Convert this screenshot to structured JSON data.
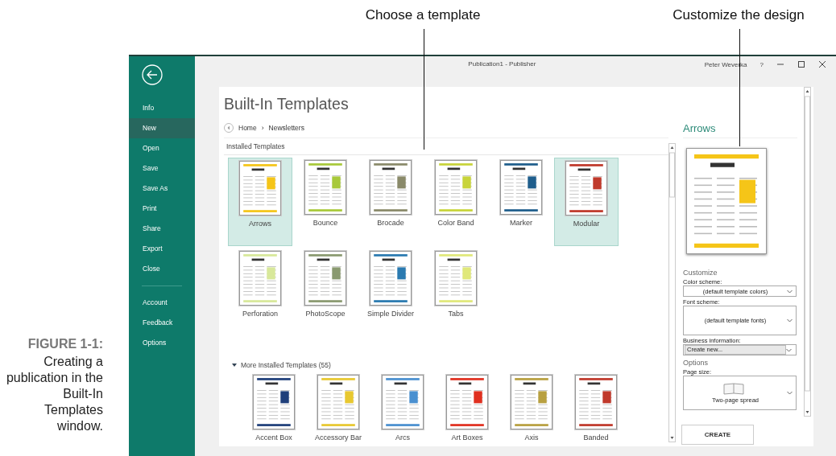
{
  "callouts": [
    {
      "text": "Choose a template"
    },
    {
      "text": "Customize the design"
    }
  ],
  "caption": {
    "label": "FIGURE 1-1:",
    "text": "Creating a publication in the Built-In Templates window."
  },
  "window": {
    "title": "Publication1 - Publisher",
    "user": "Peter Weverka",
    "help": "?"
  },
  "sidebar": {
    "sections": [
      {
        "items": [
          {
            "label": "Info",
            "selected": false
          },
          {
            "label": "New",
            "selected": true
          },
          {
            "label": "Open",
            "selected": false
          },
          {
            "label": "Save",
            "selected": false
          },
          {
            "label": "Save As",
            "selected": false
          },
          {
            "label": "Print",
            "selected": false
          },
          {
            "label": "Share",
            "selected": false
          },
          {
            "label": "Export",
            "selected": false
          },
          {
            "label": "Close",
            "selected": false
          }
        ]
      },
      {
        "items": [
          {
            "label": "Account",
            "selected": false
          },
          {
            "label": "Feedback",
            "selected": false
          },
          {
            "label": "Options",
            "selected": false
          }
        ]
      }
    ]
  },
  "gallery": {
    "title": "Built-In Templates",
    "breadcrumb": [
      "Home",
      "Newsletters"
    ],
    "breadcrumb_separator": "›",
    "installed": {
      "heading": "Installed Templates",
      "items": [
        {
          "name": "Arrows",
          "selected": true,
          "color": "#f5c518"
        },
        {
          "name": "Bounce",
          "selected": false,
          "color": "#a8c93a"
        },
        {
          "name": "Brocade",
          "selected": false,
          "color": "#8a8a6a"
        },
        {
          "name": "Color Band",
          "selected": false,
          "color": "#c8d43a"
        },
        {
          "name": "Marker",
          "selected": false,
          "color": "#1f5e8c"
        },
        {
          "name": "Modular",
          "selected": true,
          "color": "#c0392b"
        },
        {
          "name": "Perforation",
          "selected": false,
          "color": "#d8e89a"
        },
        {
          "name": "PhotoScope",
          "selected": false,
          "color": "#8a9a70"
        },
        {
          "name": "Simple Divider",
          "selected": false,
          "color": "#2a7ab0"
        },
        {
          "name": "Tabs",
          "selected": false,
          "color": "#e0e87a"
        }
      ]
    },
    "more": {
      "heading": "More Installed Templates (55)",
      "expanded": true,
      "items": [
        {
          "name": "Accent Box",
          "selected": false,
          "color": "#1f3f7a"
        },
        {
          "name": "Accessory Bar",
          "selected": false,
          "color": "#e8c830"
        },
        {
          "name": "Arcs",
          "selected": false,
          "color": "#4a90d0"
        },
        {
          "name": "Art Boxes",
          "selected": false,
          "color": "#e03020"
        },
        {
          "name": "Axis",
          "selected": false,
          "color": "#b8a040"
        },
        {
          "name": "Banded",
          "selected": false,
          "color": "#c0392b"
        }
      ]
    }
  },
  "customize": {
    "template_name": "Arrows",
    "rows": [
      {
        "kind": "heading",
        "text": "Customize"
      },
      {
        "kind": "dropdown",
        "label": "Color scheme:",
        "value": "(default template colors)"
      },
      {
        "kind": "tall_dropdown",
        "label": "Font scheme:",
        "value": "(default template fonts)"
      },
      {
        "kind": "combo",
        "label": "Business information:",
        "value": "Create new..."
      },
      {
        "kind": "heading",
        "text": "Options"
      },
      {
        "kind": "picker",
        "label": "Page size:",
        "value": "Two-page spread"
      }
    ],
    "create": "CREATE"
  }
}
